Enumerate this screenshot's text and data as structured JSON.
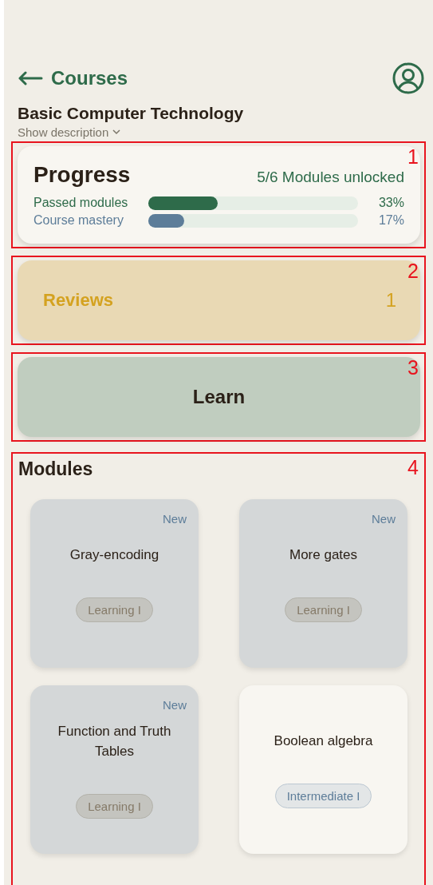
{
  "header": {
    "back_label": "Courses"
  },
  "course": {
    "title": "Basic Computer Technology",
    "description_toggle": "Show description"
  },
  "progress": {
    "annotation": "1",
    "title": "Progress",
    "unlocked": "5/6 Modules unlocked",
    "bars": [
      {
        "kind": "passed",
        "label": "Passed modules",
        "level": 0.33,
        "reading": "33%"
      },
      {
        "kind": "mastery",
        "label": "Course mastery",
        "level": 0.17,
        "reading": "17%"
      }
    ]
  },
  "reviews": {
    "annotation": "2",
    "label": "Reviews",
    "count": "1"
  },
  "learn": {
    "annotation": "3",
    "label": "Learn"
  },
  "modules": {
    "annotation": "4",
    "title": "Modules",
    "items": [
      {
        "kind": "new",
        "badge": "New",
        "title": "Gray-encoding",
        "tag": "Learning I"
      },
      {
        "kind": "new",
        "badge": "New",
        "title": "More gates",
        "tag": "Learning I"
      },
      {
        "kind": "new",
        "badge": "New",
        "title": "Function and Truth Tables",
        "tag": "Learning I"
      },
      {
        "kind": "open",
        "title": "Boolean algebra",
        "tag": "Intermediate I"
      }
    ]
  }
}
